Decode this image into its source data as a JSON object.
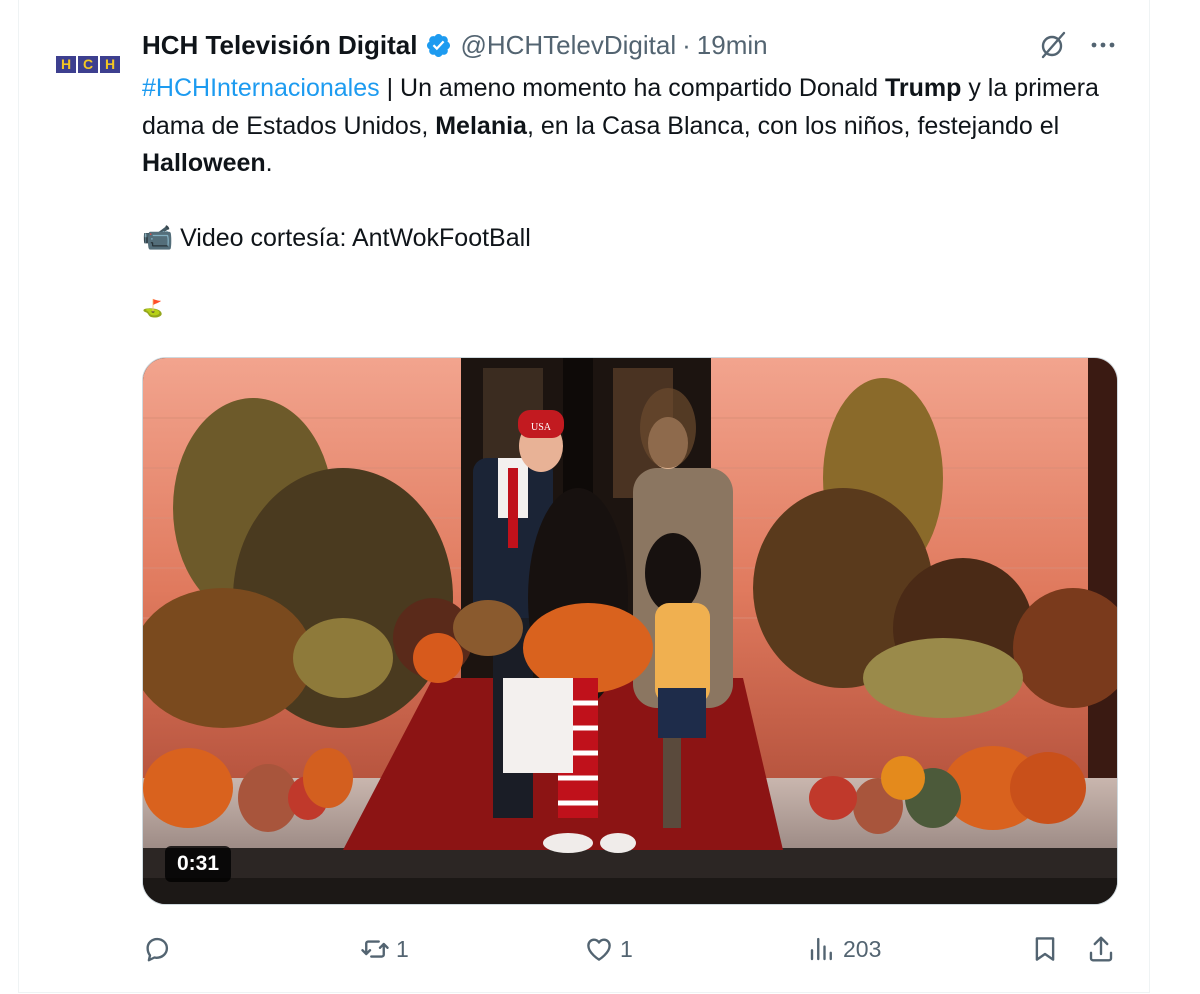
{
  "author": {
    "display_name": "HCH Televisión Digital",
    "handle": "@HCHTelevDigital",
    "separator": "·",
    "time": "19min",
    "avatar_letters": [
      "H",
      "C",
      "H"
    ],
    "avatar_colors": {
      "tile": "#3d3f8f",
      "letter": "#f3c623"
    }
  },
  "tweet": {
    "hashtag": "#HCHInternacionales",
    "t1": " | Un ameno momento ha compartido Donald ",
    "b1": "Trump",
    "t2": " y la primera dama de Estados Unidos, ",
    "b2": "Melania",
    "t3": ", en la Casa Blanca, con los niños, festejando el ",
    "b3": "Halloween",
    "t4": ".",
    "camera_emoji": "📹",
    "credit": " Video cortesía: AntWokFootBall",
    "flag_glyph": "⛳"
  },
  "media": {
    "duration": "0:31",
    "hat_text": "USA",
    "description_icon": "video-thumbnail"
  },
  "actions": {
    "reply_count": "",
    "retweet_count": "1",
    "like_count": "1",
    "views_count": "203"
  },
  "colors": {
    "link": "#1d9bf0",
    "secondary": "#536471",
    "text": "#0f1419",
    "verified": "#1d9bf0"
  }
}
